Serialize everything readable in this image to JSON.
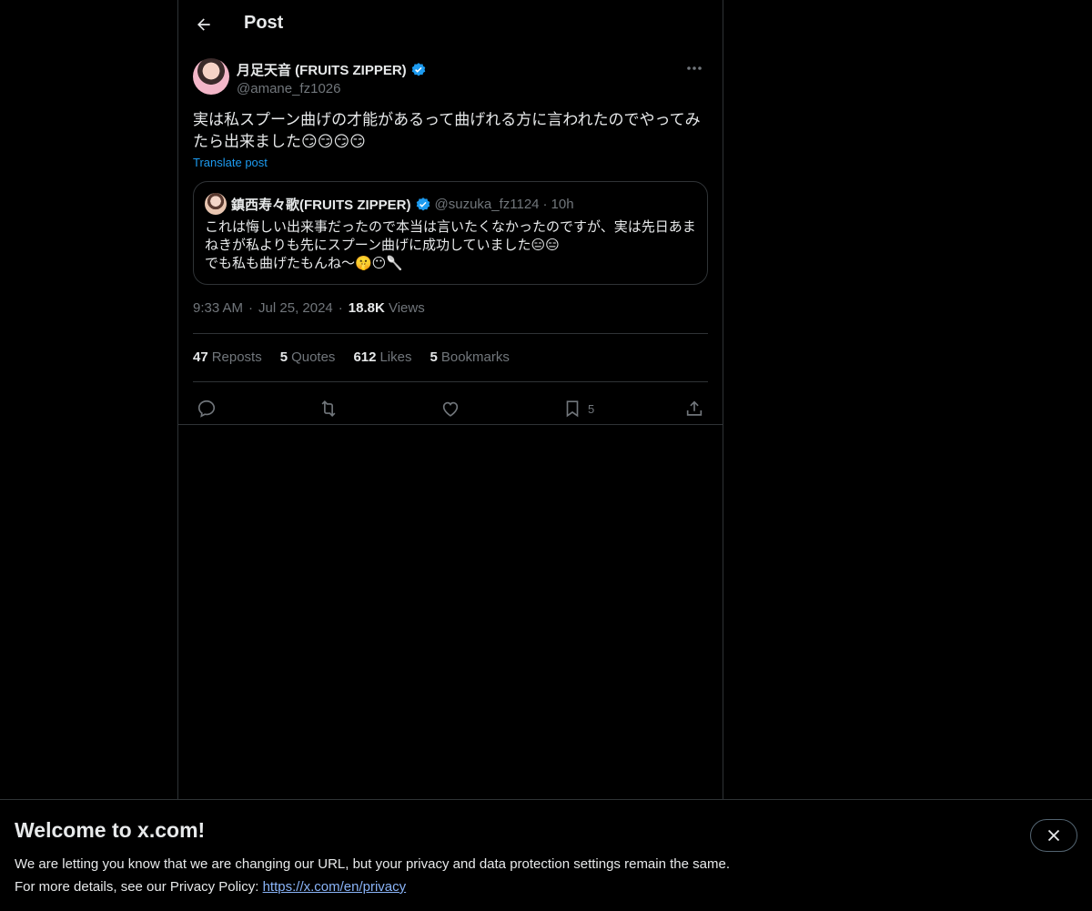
{
  "header": {
    "title": "Post"
  },
  "post": {
    "author_name": "月足天音 (FRUITS ZIPPER)",
    "author_handle": "@amane_fz1026",
    "text": "実は私スプーン曲げの才能があるって曲げれる方に言われたのでやってみたら出来ました😏😏😏😏",
    "translate_label": "Translate post",
    "time": "9:33 AM",
    "date": "Jul 25, 2024",
    "views_count": "18.8K",
    "views_label": "Views"
  },
  "quote": {
    "author_name": "鎮西寿々歌(FRUITS ZIPPER)",
    "author_handle": "@suzuka_fz1124",
    "time": "10h",
    "text": "これは悔しい出来事だったので本当は言いたくなかったのですが、実は先日あまねきが私よりも先にスプーン曲げに成功していました😑😑\nでも私も曲げたもんね〜🤫😶🥄"
  },
  "stats": [
    {
      "count": "47",
      "label": "Reposts"
    },
    {
      "count": "5",
      "label": "Quotes"
    },
    {
      "count": "612",
      "label": "Likes"
    },
    {
      "count": "5",
      "label": "Bookmarks"
    }
  ],
  "actions": {
    "bookmark_count": "5"
  },
  "banner": {
    "title": "Welcome to x.com!",
    "line1": "We are letting you know that we are changing our URL, but your privacy and data protection settings remain the same.",
    "line2_prefix": "For more details, see our Privacy Policy: ",
    "link": "https://x.com/en/privacy"
  },
  "colors": {
    "background": "#000000",
    "text": "#e7e9ea",
    "muted": "#71767b",
    "accent": "#1d9bf0",
    "border": "#2f3336"
  },
  "icons": [
    "back-arrow-icon",
    "verified-badge-icon",
    "more-icon",
    "reply-icon",
    "repost-icon",
    "like-icon",
    "bookmark-icon",
    "share-icon",
    "close-icon"
  ]
}
